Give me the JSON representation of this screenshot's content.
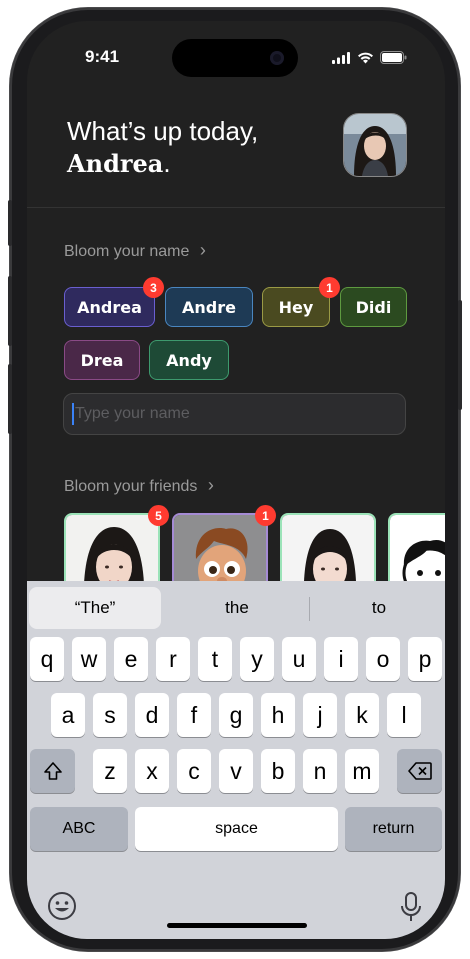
{
  "status": {
    "time": "9:41"
  },
  "greeting": {
    "line1": "What’s up today,",
    "name": "Andrea",
    "punct": "."
  },
  "bloom_name": {
    "title": "Bloom your name",
    "chevron": "›",
    "chips": [
      {
        "label": "Andrea",
        "badge": "3",
        "bg": "#2f2a5e",
        "border": "#6a5fd0"
      },
      {
        "label": "Andre",
        "badge": "",
        "bg": "#1e3a55",
        "border": "#4a86c0"
      },
      {
        "label": "Hey",
        "badge": "1",
        "bg": "#4a4a20",
        "border": "#9a9a45"
      },
      {
        "label": "Didi",
        "badge": "",
        "bg": "#2b4a20",
        "border": "#5e9a40"
      },
      {
        "label": "Drea",
        "badge": "",
        "bg": "#4a2848",
        "border": "#8a4a86"
      },
      {
        "label": "Andy",
        "badge": "",
        "bg": "#1e4a36",
        "border": "#3e9a6e"
      }
    ],
    "input_placeholder": "Type your name"
  },
  "bloom_friends": {
    "title": "Bloom your friends",
    "chevron": "›",
    "cards": [
      {
        "badge": "5",
        "icon": "friend-photo-woman"
      },
      {
        "badge": "1",
        "icon": "friend-cartoon-boy"
      },
      {
        "badge": "",
        "icon": "friend-photo-woman-2"
      },
      {
        "badge": "",
        "icon": "friend-cartoon-sketch"
      }
    ]
  },
  "keyboard": {
    "suggestions": [
      "“The”",
      "the",
      "to"
    ],
    "row1": [
      "q",
      "w",
      "e",
      "r",
      "t",
      "y",
      "u",
      "i",
      "o",
      "p"
    ],
    "row2": [
      "a",
      "s",
      "d",
      "f",
      "g",
      "h",
      "j",
      "k",
      "l"
    ],
    "row3": [
      "z",
      "x",
      "c",
      "v",
      "b",
      "n",
      "m"
    ],
    "abc_label": "ABC",
    "space_label": "space",
    "return_label": "return"
  },
  "colors": {
    "badge": "#ff3b30",
    "caret": "#3a82f7"
  }
}
